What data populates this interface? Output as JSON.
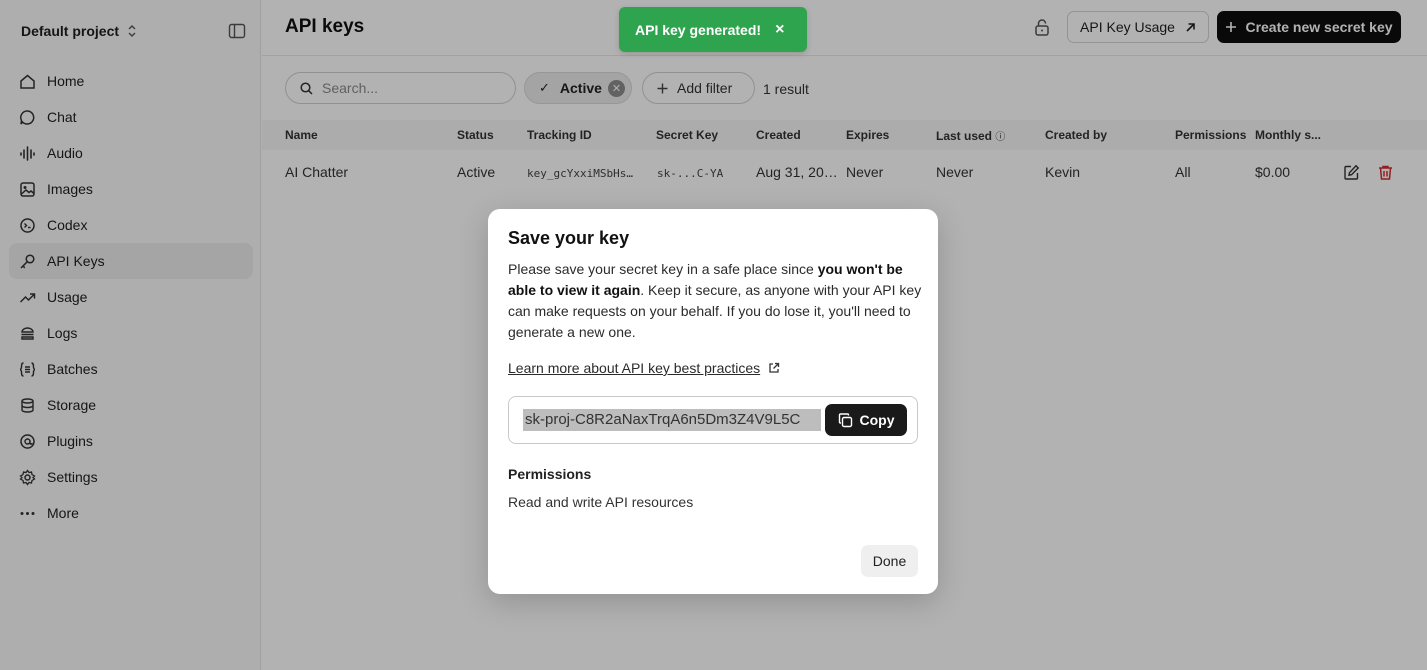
{
  "sidebar": {
    "project_name": "Default project",
    "items": [
      {
        "label": "Home",
        "icon": "home-icon"
      },
      {
        "label": "Chat",
        "icon": "chat-icon"
      },
      {
        "label": "Audio",
        "icon": "audio-icon"
      },
      {
        "label": "Images",
        "icon": "image-icon"
      },
      {
        "label": "Codex",
        "icon": "codex-icon"
      },
      {
        "label": "API Keys",
        "icon": "key-icon",
        "active": true
      },
      {
        "label": "Usage",
        "icon": "usage-icon"
      },
      {
        "label": "Logs",
        "icon": "logs-icon"
      },
      {
        "label": "Batches",
        "icon": "batches-icon"
      },
      {
        "label": "Storage",
        "icon": "storage-icon"
      },
      {
        "label": "Plugins",
        "icon": "plugins-icon"
      },
      {
        "label": "Settings",
        "icon": "settings-icon"
      },
      {
        "label": "More",
        "icon": "more-icon"
      }
    ]
  },
  "header": {
    "title": "API keys",
    "usage_label": "API Key Usage",
    "create_label": "Create new secret key"
  },
  "filters": {
    "search_placeholder": "Search...",
    "active_chip": "Active",
    "add_filter": "Add filter",
    "result_count": "1 result"
  },
  "table": {
    "columns": [
      "Name",
      "Status",
      "Tracking ID",
      "Secret Key",
      "Created",
      "Expires",
      "Last used",
      "Created by",
      "Permissions",
      "Monthly s..."
    ],
    "rows": [
      [
        "AI Chatter",
        "Active",
        "key_gcYxxiMSbHs…",
        "sk-...C-YA",
        "Aug 31, 20…",
        "Never",
        "Never",
        "Kevin",
        "All",
        "$0.00"
      ]
    ]
  },
  "toast": {
    "message": "API key generated!",
    "close": "×",
    "color": "#2ea44f"
  },
  "modal": {
    "title": "Save your key",
    "body_pre": "Please save your secret key in a safe place since ",
    "body_bold": "you won't be able to view it again",
    "body_post": ". Keep it secure, as anyone with your API key can make requests on your behalf. If you do lose it, you'll need to generate a new one.",
    "learn_link": "Learn more about API key best practices",
    "key_value": "sk-proj-C8R2aNaxTrqA6n5Dm3Z4V9L5C",
    "copy_label": "Copy",
    "permissions_title": "Permissions",
    "permissions_value": "Read and write API resources",
    "done_label": "Done"
  }
}
